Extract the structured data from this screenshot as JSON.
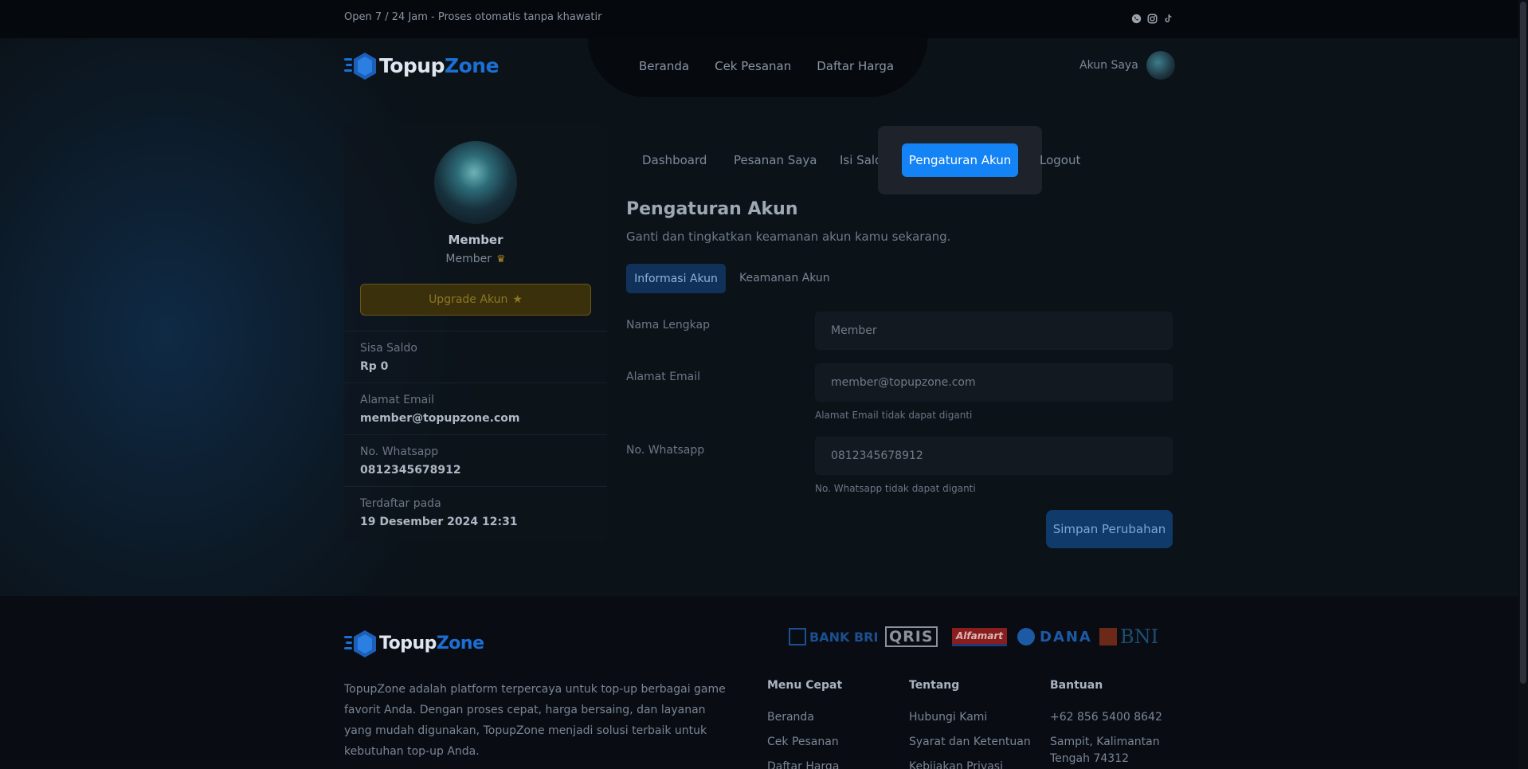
{
  "topbar": {
    "text": "Open 7 / 24 Jam - Proses otomatis tanpa khawatir",
    "icons": [
      "whatsapp-icon",
      "instagram-icon",
      "tiktok-icon"
    ]
  },
  "brand": {
    "name_part1": "Topup",
    "name_part2": "Zone"
  },
  "nav": {
    "items": [
      "Beranda",
      "Cek Pesanan",
      "Daftar Harga"
    ]
  },
  "account": {
    "label": "Akun Saya"
  },
  "profile": {
    "name": "Member",
    "role": "Member",
    "upgrade_label": "Upgrade Akun",
    "info": [
      {
        "label": "Sisa Saldo",
        "value": "Rp 0"
      },
      {
        "label": "Alamat Email",
        "value": "member@topupzone.com"
      },
      {
        "label": "No. Whatsapp",
        "value": "0812345678912"
      },
      {
        "label": "Terdaftar pada",
        "value": "19 Desember 2024 12:31"
      }
    ]
  },
  "tabs": {
    "items": [
      "Dashboard",
      "Pesanan Saya",
      "Isi Saldo",
      "Pengaturan Akun",
      "Logout"
    ],
    "active": "Pengaturan Akun"
  },
  "settings": {
    "title": "Pengaturan Akun",
    "subtitle": "Ganti dan tingkatkan keamanan akun kamu sekarang.",
    "subtabs": [
      "Informasi Akun",
      "Keamanan Akun"
    ],
    "fields": [
      {
        "label": "Nama Lengkap",
        "value": "Member",
        "hint": ""
      },
      {
        "label": "Alamat Email",
        "value": "member@topupzone.com",
        "hint": "Alamat Email tidak dapat diganti"
      },
      {
        "label": "No. Whatsapp",
        "value": "0812345678912",
        "hint": "No. Whatsapp tidak dapat diganti"
      }
    ],
    "save_label": "Simpan Perubahan"
  },
  "footer": {
    "payments": [
      "BANK BRI",
      "QRIS",
      "Alfamart",
      "DANA",
      "BNI"
    ],
    "description": "TopupZone adalah platform terpercaya untuk top-up berbagai game favorit Anda. Dengan proses cepat, harga bersaing, dan layanan yang mudah digunakan, TopupZone menjadi solusi terbaik untuk kebutuhan top-up Anda.",
    "columns": [
      {
        "title": "Menu Cepat",
        "links": [
          "Beranda",
          "Cek Pesanan",
          "Daftar Harga"
        ]
      },
      {
        "title": "Tentang",
        "links": [
          "Hubungi Kami",
          "Syarat dan Ketentuan",
          "Kebijakan Privasi"
        ]
      },
      {
        "title": "Bantuan",
        "links": [
          "+62 856 5400 8642",
          "Sampit, Kalimantan",
          "Tengah 74312"
        ]
      }
    ]
  },
  "colors": {
    "accent": "#1483f5",
    "background": "#0b1218",
    "gold": "#b38a1f"
  }
}
